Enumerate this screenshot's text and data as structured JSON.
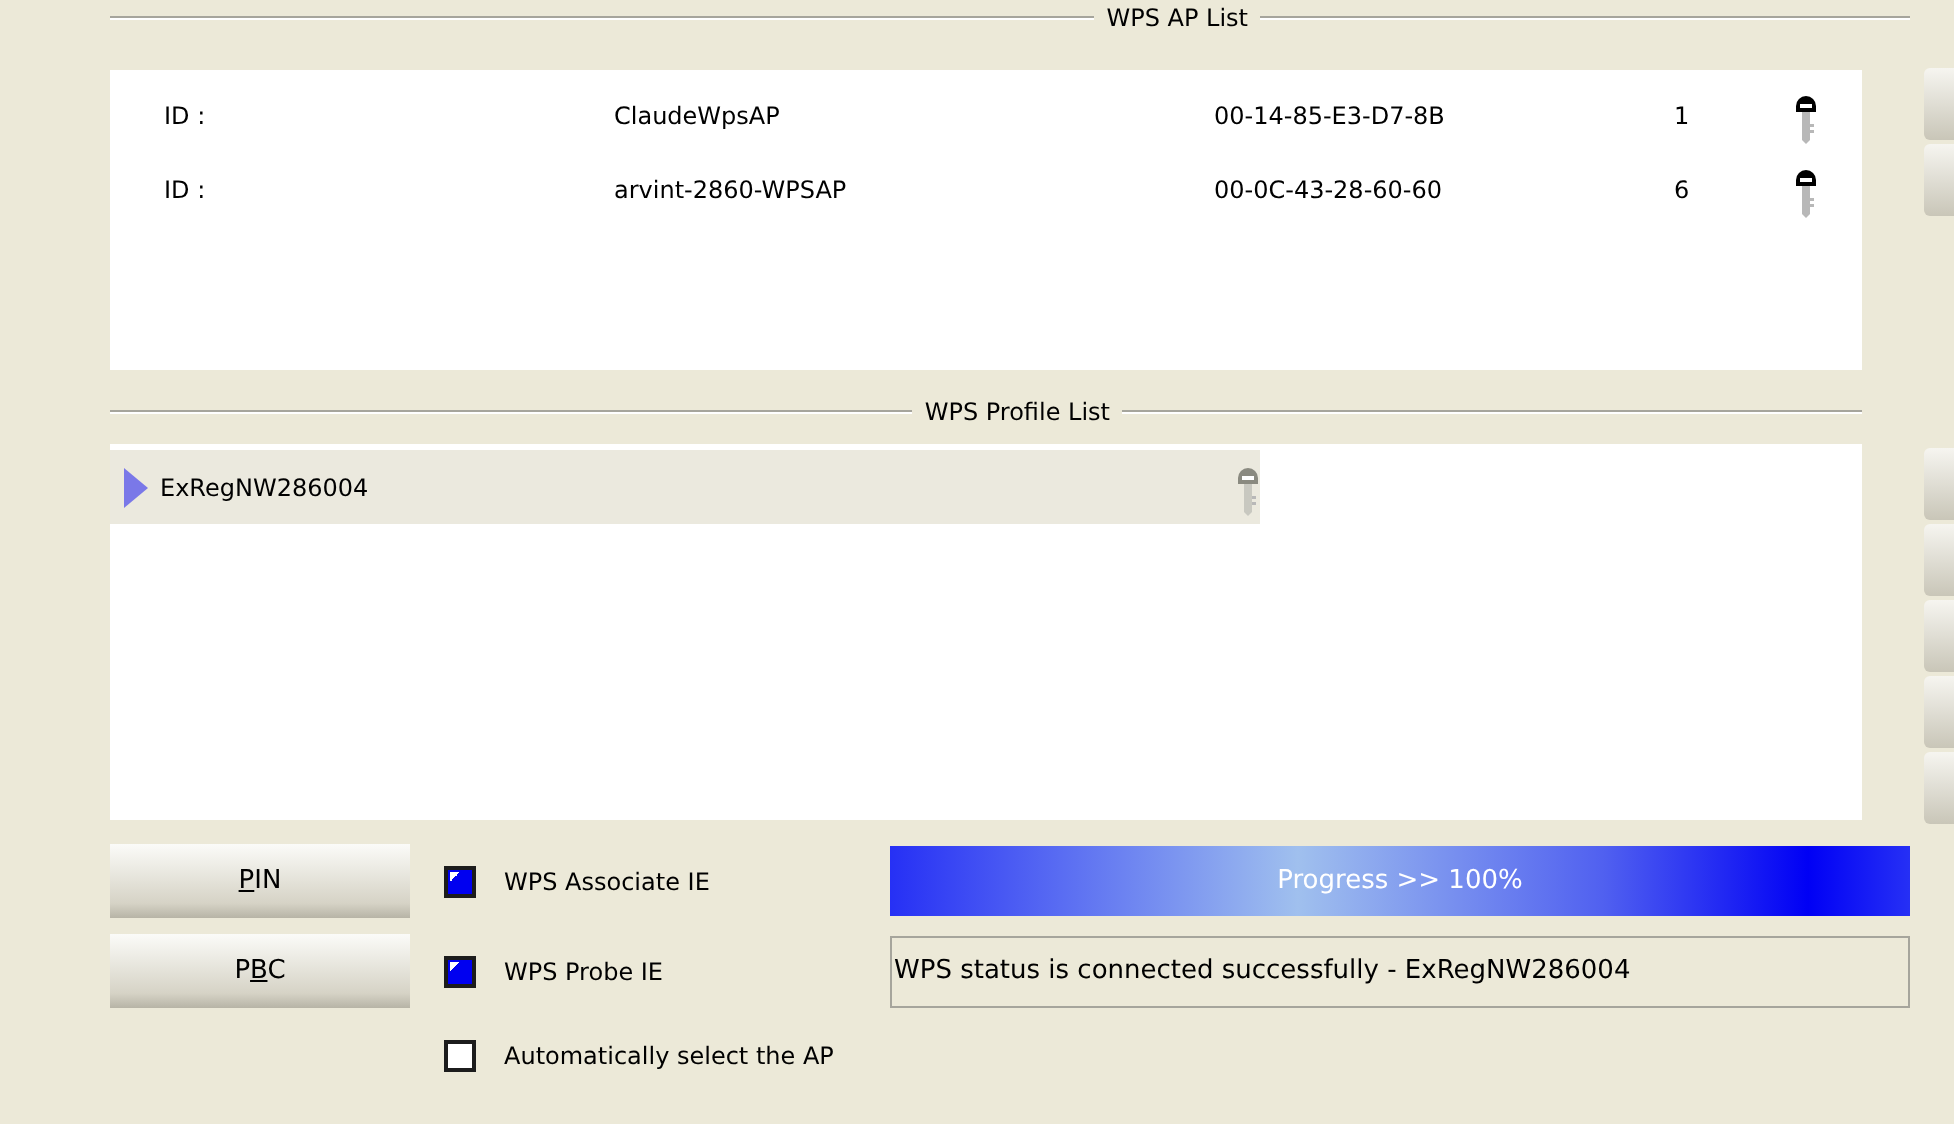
{
  "ap_list": {
    "title": "WPS AP List",
    "rows": [
      {
        "id_label": "ID :",
        "ssid": "ClaudeWpsAP",
        "bssid": "00-14-85-E3-D7-8B",
        "channel": "1"
      },
      {
        "id_label": "ID :",
        "ssid": "arvint-2860-WPSAP",
        "bssid": "00-0C-43-28-60-60",
        "channel": "6"
      }
    ]
  },
  "profile_list": {
    "title": "WPS Profile List",
    "items": [
      {
        "name": "ExRegNW286004",
        "selected": true
      }
    ]
  },
  "buttons": [
    {
      "key": "P",
      "after": "IN"
    },
    {
      "before": "P",
      "key": "B",
      "after": "C"
    }
  ],
  "options": [
    {
      "label": "WPS Associate IE",
      "checked": true
    },
    {
      "label": "WPS Probe IE",
      "checked": true
    },
    {
      "label": "Automatically select the AP",
      "checked": false
    }
  ],
  "progress": {
    "text": "Progress >> 100%",
    "level": 1
  },
  "status": {
    "value": "WPS status is connected successfully - ExRegNW286004"
  }
}
